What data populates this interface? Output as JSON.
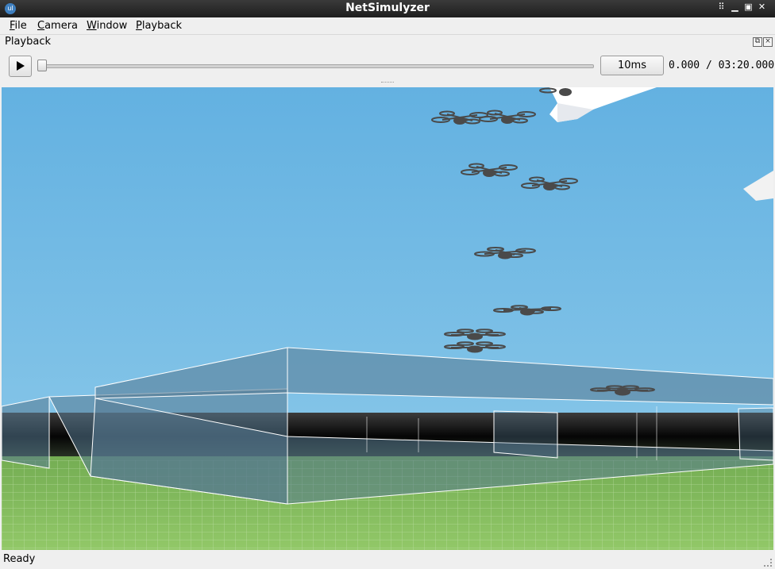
{
  "window": {
    "title": "NetSimulyzer",
    "app_icon": "app-logo-icon",
    "controls": [
      "pin-icon",
      "minimize-icon",
      "maximize-icon",
      "close-icon"
    ]
  },
  "menu": {
    "items": [
      "File",
      "Camera",
      "Window",
      "Playback"
    ]
  },
  "dock": {
    "title": "Playback",
    "float_icon": "float-icon",
    "close_icon": "close-icon"
  },
  "playback": {
    "play_icon": "play-icon",
    "slider_progress": 0.0,
    "step_label": "10ms",
    "time_readout": "0.000 / 03:20.000"
  },
  "colors": {
    "sky": "#6cb6e0",
    "ground": "#86bf5e",
    "building": "#56788f",
    "drone": "#4a4a4a",
    "cloud": "#ffffff"
  },
  "status": {
    "text": "Ready"
  }
}
